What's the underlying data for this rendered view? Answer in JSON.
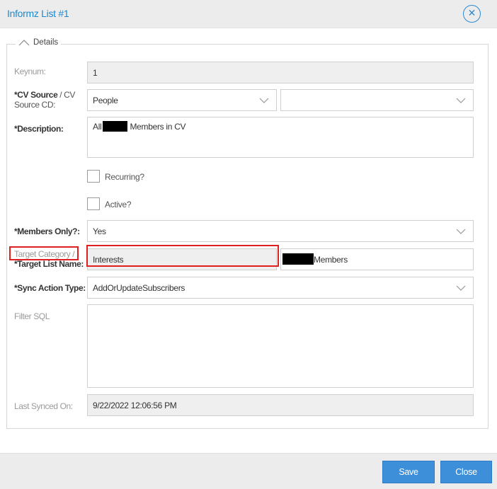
{
  "dialog": {
    "title": "Informz List #1"
  },
  "section": {
    "legend": "Details"
  },
  "fields": {
    "keynum": {
      "label": "Keynum:",
      "value": "1"
    },
    "cv_source": {
      "label_bold": "*CV Source",
      "label_rest": " / CV Source CD:",
      "value": "People",
      "cd_value": ""
    },
    "description": {
      "label": "*Description:",
      "value_prefix": "All",
      "value_suffix": " Members in CV"
    },
    "recurring": {
      "label": "Recurring?",
      "checked": false
    },
    "active": {
      "label": "Active?",
      "checked": false
    },
    "members_only": {
      "label": "*Members Only?:",
      "value": "Yes"
    },
    "target": {
      "label_line1": "Target Category /",
      "label_line2": "*Target List Name:",
      "category_value": "Interests",
      "list_name_suffix": "Members"
    },
    "sync_action": {
      "label": "*Sync Action Type:",
      "value": "AddOrUpdateSubscribers"
    },
    "filter_sql": {
      "label": "Filter SQL",
      "value": ""
    },
    "last_synced": {
      "label": "Last Synced On:",
      "value": "9/22/2022 12:06:56 PM"
    }
  },
  "footer": {
    "save_label": "Save",
    "close_label": "Close"
  },
  "colors": {
    "accent": "#1e88cf",
    "button": "#3d8fd9",
    "highlight": "#e02020",
    "title_bar": "#ececec"
  }
}
